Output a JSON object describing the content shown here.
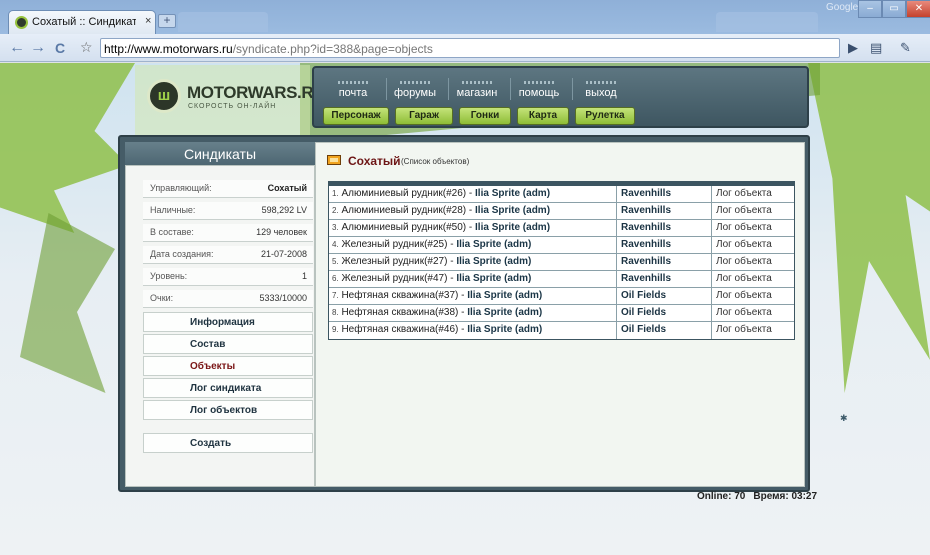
{
  "browser": {
    "tab_title": "Сохатый :: Синдикаты :: ...",
    "tab_close": "×",
    "new_tab": "+",
    "window_label": "Google",
    "window_buttons": [
      "–",
      "▭",
      "✕"
    ],
    "back_icon": "←",
    "forward_icon": "→",
    "reload_icon": "C",
    "star_icon": "☆",
    "url_host": "http://www.motorwars.ru",
    "url_path": "/syndicate.php?id=388&page=objects",
    "play_icon": "▶",
    "page_icon": "▤",
    "wrench_icon": "✎"
  },
  "site": {
    "logo_glyph": "ш",
    "logo_name": "MOTORWARS.RU",
    "tagline": "СКОРОСТЬ ОН-ЛАЙН"
  },
  "top_nav": [
    "почта",
    "форумы",
    "магазин",
    "помощь",
    "выход"
  ],
  "game_nav": [
    "Персонаж",
    "Гараж",
    "Гонки",
    "Карта",
    "Рулетка"
  ],
  "sidebar": {
    "title": "Синдикаты",
    "info": [
      {
        "label": "Управляющий:",
        "value": "Сохатый"
      },
      {
        "label": "Наличные:",
        "value": "598,292 LV"
      },
      {
        "label": "В составе:",
        "value": "129 человек"
      },
      {
        "label": "Дата создания:",
        "value": "21-07-2008"
      },
      {
        "label": "Уровень:",
        "value": "1"
      },
      {
        "label": "Очки:",
        "value": "5333/10000"
      }
    ],
    "links": [
      "Информация",
      "Состав",
      "Объекты",
      "Лог синдиката",
      "Лог объектов"
    ],
    "create": "Создать"
  },
  "content": {
    "title": "Сохатый",
    "subtitle": "(Список объектов)",
    "objects": [
      {
        "num": "1.",
        "name": "Алюминиевый рудник(#26)",
        "sep": " - ",
        "owner": "Ilia Sprite (adm)",
        "location": "Ravenhills",
        "log": "Лог объекта"
      },
      {
        "num": "2.",
        "name": "Алюминиевый рудник(#28)",
        "sep": " - ",
        "owner": "Ilia Sprite (adm)",
        "location": "Ravenhills",
        "log": "Лог объекта"
      },
      {
        "num": "3.",
        "name": "Алюминиевый рудник(#50)",
        "sep": " - ",
        "owner": "Ilia Sprite (adm)",
        "location": "Ravenhills",
        "log": "Лог объекта"
      },
      {
        "num": "4.",
        "name": "Железный рудник(#25)",
        "sep": " - ",
        "owner": "Ilia Sprite (adm)",
        "location": "Ravenhills",
        "log": "Лог объекта"
      },
      {
        "num": "5.",
        "name": "Железный рудник(#27)",
        "sep": " - ",
        "owner": "Ilia Sprite (adm)",
        "location": "Ravenhills",
        "log": "Лог объекта"
      },
      {
        "num": "6.",
        "name": "Железный рудник(#47)",
        "sep": " - ",
        "owner": "Ilia Sprite (adm)",
        "location": "Ravenhills",
        "log": "Лог объекта"
      },
      {
        "num": "7.",
        "name": "Нефтяная скважина(#37)",
        "sep": " - ",
        "owner": "Ilia Sprite (adm)",
        "location": "Oil Fields",
        "log": "Лог объекта"
      },
      {
        "num": "8.",
        "name": "Нефтяная скважина(#38)",
        "sep": " - ",
        "owner": "Ilia Sprite (adm)",
        "location": "Oil Fields",
        "log": "Лог объекта"
      },
      {
        "num": "9.",
        "name": "Нефтяная скважина(#46)",
        "sep": " - ",
        "owner": "Ilia Sprite (adm)",
        "location": "Oil Fields",
        "log": "Лог объекта"
      }
    ]
  },
  "footer": {
    "online": "Online: 70",
    "time": "Время: 03:27"
  },
  "misc": {
    "tiny_mark": "✱"
  }
}
